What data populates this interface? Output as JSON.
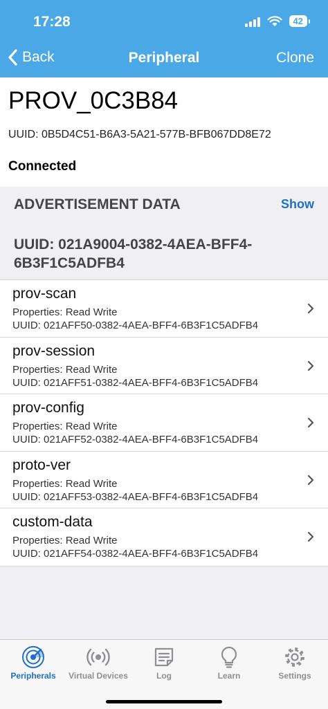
{
  "status_bar": {
    "time": "17:28",
    "battery": "42"
  },
  "nav": {
    "back_label": "Back",
    "title": "Peripheral",
    "action_label": "Clone"
  },
  "device": {
    "name": "PROV_0C3B84",
    "uuid": "UUID: 0B5D4C51-B6A3-5A21-577B-BFB067DD8E72",
    "status": "Connected"
  },
  "advertisement": {
    "title": "ADVERTISEMENT DATA",
    "show_label": "Show"
  },
  "service": {
    "uuid": "UUID: 021A9004-0382-4AEA-BFF4-6B3F1C5ADFB4"
  },
  "characteristics": [
    {
      "name": "prov-scan",
      "properties": "Properties: Read Write",
      "uuid": "UUID: 021AFF50-0382-4AEA-BFF4-6B3F1C5ADFB4"
    },
    {
      "name": "prov-session",
      "properties": "Properties: Read Write",
      "uuid": "UUID: 021AFF51-0382-4AEA-BFF4-6B3F1C5ADFB4"
    },
    {
      "name": "prov-config",
      "properties": "Properties: Read Write",
      "uuid": "UUID: 021AFF52-0382-4AEA-BFF4-6B3F1C5ADFB4"
    },
    {
      "name": "proto-ver",
      "properties": "Properties: Read Write",
      "uuid": "UUID: 021AFF53-0382-4AEA-BFF4-6B3F1C5ADFB4"
    },
    {
      "name": "custom-data",
      "properties": "Properties: Read Write",
      "uuid": "UUID: 021AFF54-0382-4AEA-BFF4-6B3F1C5ADFB4"
    }
  ],
  "tabs": [
    {
      "label": "Peripherals",
      "icon": "radar-icon"
    },
    {
      "label": "Virtual Devices",
      "icon": "broadcast-icon"
    },
    {
      "label": "Log",
      "icon": "log-icon"
    },
    {
      "label": "Learn",
      "icon": "lightbulb-icon"
    },
    {
      "label": "Settings",
      "icon": "gear-icon"
    }
  ],
  "colors": {
    "header": "#4ba8e6",
    "accent": "#1f6fc9",
    "inactive": "#8e8e93"
  }
}
